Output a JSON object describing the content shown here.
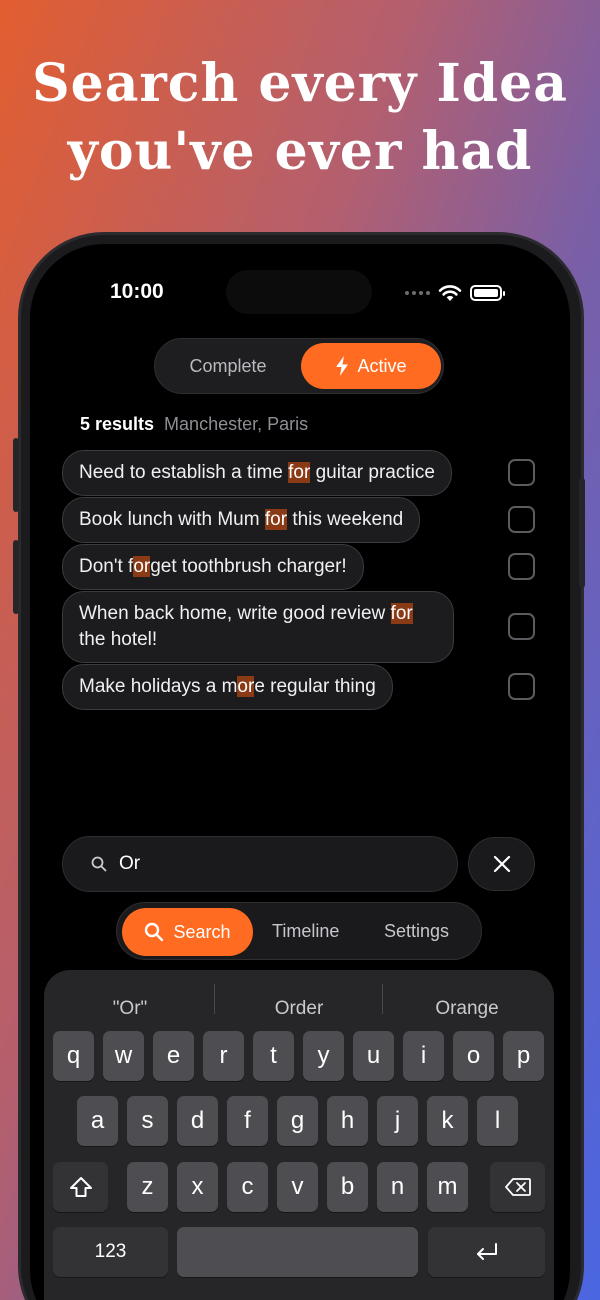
{
  "headline": {
    "line1": "Search every Idea",
    "line2": "you've ever had"
  },
  "status_bar": {
    "time": "10:00"
  },
  "filter": {
    "complete_label": "Complete",
    "active_label": "Active",
    "selected": "Active"
  },
  "results": {
    "count_label": "5 results",
    "locations": "Manchester, Paris"
  },
  "items": [
    {
      "parts": [
        "Need to establish a time ",
        "for",
        " guitar practice"
      ],
      "checked": false
    },
    {
      "parts": [
        "Book lunch with Mum ",
        "for",
        " this weekend"
      ],
      "checked": false
    },
    {
      "parts": [
        "Don't f",
        "or",
        "get toothbrush charger!"
      ],
      "checked": false
    },
    {
      "parts": [
        "When back home, write good review ",
        "for",
        " the hotel!"
      ],
      "checked": false
    },
    {
      "parts": [
        "Make holidays a m",
        "or",
        "e regular thing"
      ],
      "checked": false
    }
  ],
  "search": {
    "value": "Or"
  },
  "tabs": {
    "search": "Search",
    "timeline": "Timeline",
    "settings": "Settings",
    "selected": "Search"
  },
  "keyboard": {
    "suggestions": [
      "\"Or\"",
      "Order",
      "Orange"
    ],
    "row1": [
      "q",
      "w",
      "e",
      "r",
      "t",
      "y",
      "u",
      "i",
      "o",
      "p"
    ],
    "row2": [
      "a",
      "s",
      "d",
      "f",
      "g",
      "h",
      "j",
      "k",
      "l"
    ],
    "row3": [
      "z",
      "x",
      "c",
      "v",
      "b",
      "n",
      "m"
    ],
    "numbers_label": "123"
  },
  "colors": {
    "accent": "#ff6b21",
    "highlight": "#8a3a14",
    "background": "#000000"
  },
  "icons": [
    "bolt-icon",
    "search-icon",
    "close-icon",
    "wifi-icon",
    "battery-icon",
    "shift-icon",
    "backspace-icon",
    "return-icon"
  ]
}
